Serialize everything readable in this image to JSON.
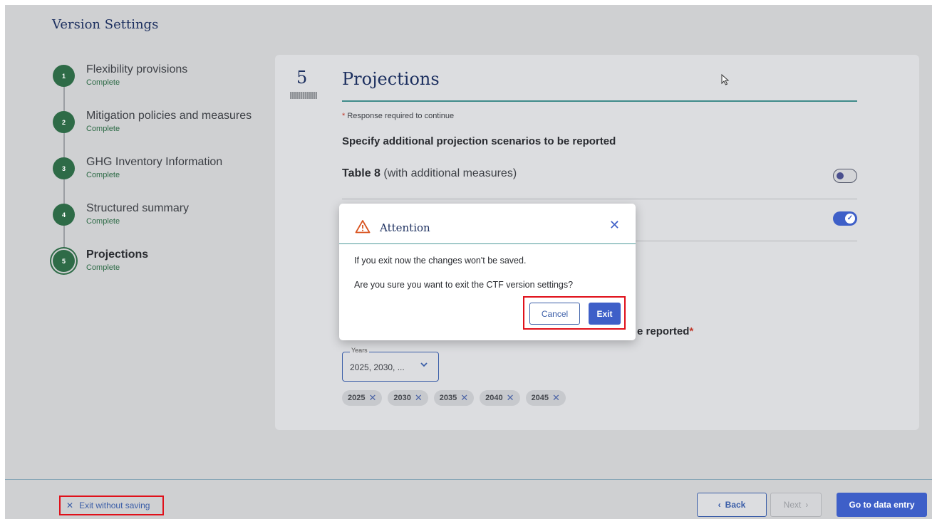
{
  "page": {
    "title": "Version Settings"
  },
  "stepper": {
    "steps": [
      {
        "number": "1",
        "title": "Flexibility provisions",
        "status": "Complete"
      },
      {
        "number": "2",
        "title": "Mitigation policies and measures",
        "status": "Complete"
      },
      {
        "number": "3",
        "title": "GHG Inventory Information",
        "status": "Complete"
      },
      {
        "number": "4",
        "title": "Structured summary",
        "status": "Complete"
      },
      {
        "number": "5",
        "title": "Projections",
        "status": "Complete"
      }
    ]
  },
  "card": {
    "step_number": "5",
    "title": "Projections",
    "required_star": "*",
    "required_note": "Response required to continue",
    "section_heading": "Specify additional projection scenarios to be reported",
    "table8_bold": "Table 8",
    "table8_rest": "(with additional measures)",
    "toggle_on_check": "✓",
    "years_heading_fragment": "e reported",
    "years_heading_star": "*",
    "years_select": {
      "label": "Years",
      "value": "2025, 2030, ...",
      "chevron": "⌄"
    },
    "year_chips": [
      "2025",
      "2030",
      "2035",
      "2040",
      "2045"
    ],
    "chip_remove": "✕"
  },
  "modal": {
    "title": "Attention",
    "close": "✕",
    "line1": "If you exit now the changes won't be saved.",
    "line2": "Are you sure you want to exit the CTF version settings?",
    "cancel": "Cancel",
    "exit": "Exit"
  },
  "footer": {
    "exit_icon": "✕",
    "exit_label": "Exit without saving",
    "back_chevron": "‹",
    "back": "Back",
    "next": "Next",
    "next_chevron": "›",
    "go": "Go to data entry"
  },
  "colors": {
    "accent": "#3e5fc8",
    "navy": "#1c2f5f",
    "complete_green": "#2e6b47",
    "highlight_red": "#e0101a",
    "warning_orange": "#d9531e"
  }
}
